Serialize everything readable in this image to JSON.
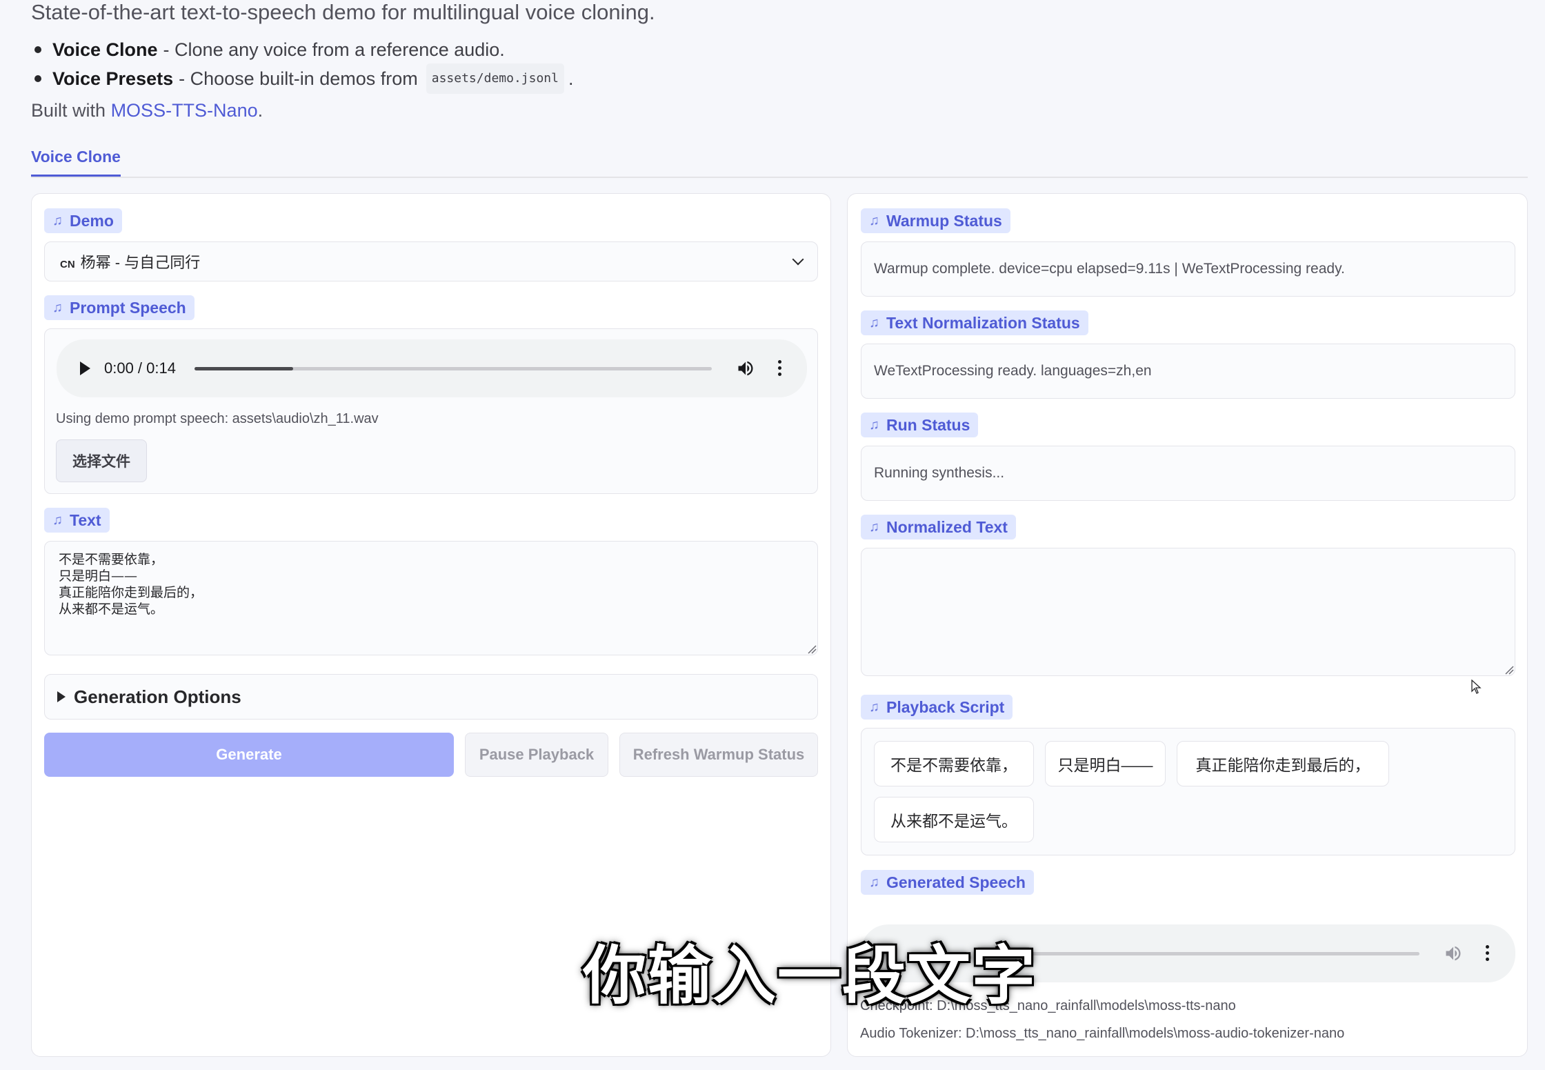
{
  "header": {
    "subtitle": "State-of-the-art text-to-speech demo for multilingual voice cloning.",
    "features": [
      {
        "name": "Voice Clone",
        "desc": "- Clone any voice from a reference audio.",
        "code": "",
        "tail": ""
      },
      {
        "name": "Voice Presets",
        "desc": "- Choose built-in demos from",
        "code": "assets/demo.jsonl",
        "tail": "."
      }
    ],
    "built_with_prefix": "Built with",
    "built_with_link": "MOSS-TTS-Nano",
    "built_with_suffix": "."
  },
  "tabs": [
    {
      "label": "Voice Clone",
      "active": true
    }
  ],
  "left_panel": {
    "demo": {
      "label": "Demo",
      "flag": "CN",
      "selected": "杨幂 - 与自己同行"
    },
    "prompt_speech": {
      "label": "Prompt Speech",
      "time": "0:00 / 0:14",
      "progress": 0.19,
      "info": "Using demo prompt speech: assets\\audio\\zh_11.wav",
      "file_button": "选择文件"
    },
    "text": {
      "label": "Text",
      "value": "不是不需要依靠，\n只是明白——\n真正能陪你走到最后的，\n从来都不是运气。"
    },
    "generation_options": {
      "label": "Generation Options"
    },
    "buttons": {
      "generate": "Generate",
      "pause": "Pause Playback",
      "refresh": "Refresh Warmup Status"
    }
  },
  "right_panel": {
    "warmup": {
      "label": "Warmup Status",
      "value": "Warmup complete. device=cpu elapsed=9.11s | WeTextProcessing ready."
    },
    "text_norm": {
      "label": "Text Normalization Status",
      "value": "WeTextProcessing ready. languages=zh,en"
    },
    "run_status": {
      "label": "Run Status",
      "value": "Running synthesis..."
    },
    "normalized_text": {
      "label": "Normalized Text",
      "value": ""
    },
    "playback_script": {
      "label": "Playback Script",
      "chips": [
        "不是不需要依靠，",
        "只是明白——",
        "真正能陪你走到最后的，",
        "从来都不是运气。"
      ]
    },
    "generated_speech": {
      "label": "Generated Speech",
      "progress": 0.0
    },
    "checkpoint": "Checkpoint: D:\\moss_tts_nano_rainfall\\models\\moss-tts-nano",
    "audio_tokenizer": "Audio Tokenizer: D:\\moss_tts_nano_rainfall\\models\\moss-audio-tokenizer-nano"
  },
  "overlay": {
    "subtitle": "你输入一段文字"
  },
  "icons": [
    "music-note-icon",
    "chevron-down-icon",
    "play-icon",
    "volume-icon",
    "more-vertical-icon",
    "resize-handle-icon",
    "expand-triangle-icon",
    "mouse-cursor-icon"
  ],
  "colors": {
    "accent": "#4f5bd5",
    "chip_bg": "#e0e7ff",
    "primary_button": "#a5aefa",
    "page_bg": "#f6f7fb"
  }
}
